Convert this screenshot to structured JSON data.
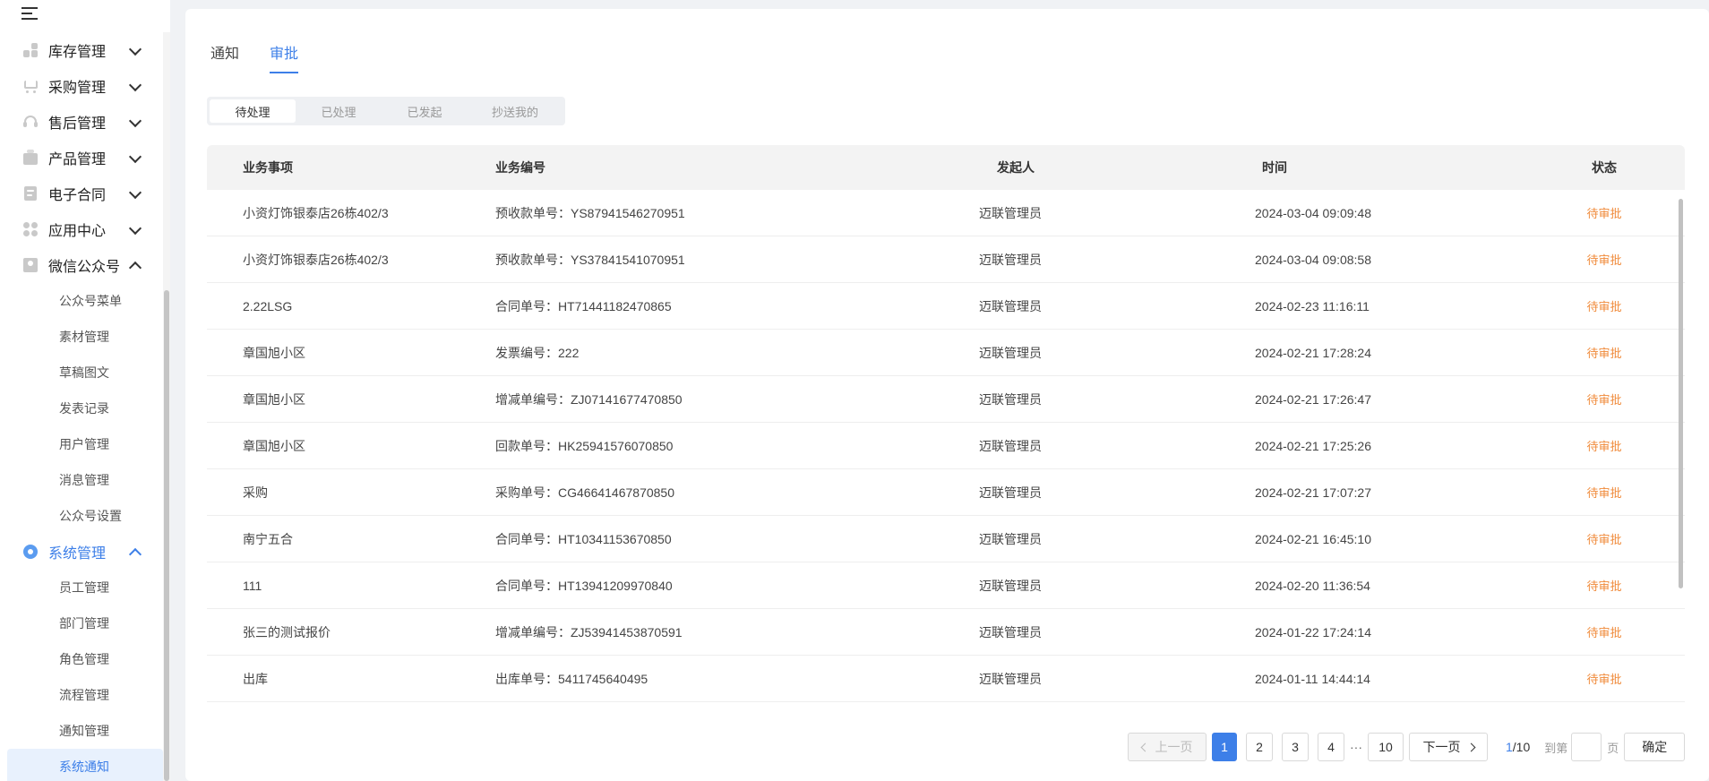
{
  "sidebar": {
    "groups": [
      {
        "label": "库存管理",
        "icon": "inventory-icon"
      },
      {
        "label": "采购管理",
        "icon": "cart-icon"
      },
      {
        "label": "售后管理",
        "icon": "headset-icon"
      },
      {
        "label": "产品管理",
        "icon": "product-icon"
      },
      {
        "label": "电子合同",
        "icon": "contract-icon"
      },
      {
        "label": "应用中心",
        "icon": "apps-icon"
      },
      {
        "label": "微信公众号",
        "icon": "wechat-official-icon"
      }
    ],
    "wechat_sub": [
      "公众号菜单",
      "素材管理",
      "草稿图文",
      "发表记录",
      "用户管理",
      "消息管理",
      "公众号设置"
    ],
    "system_group": {
      "label": "系统管理",
      "icon": "system-settings-icon"
    },
    "system_sub": [
      "员工管理",
      "部门管理",
      "角色管理",
      "流程管理",
      "通知管理",
      "系统通知"
    ],
    "accent_color": "#3d7fe8"
  },
  "main": {
    "tabs": [
      "通知",
      "审批"
    ],
    "active_tab": "审批",
    "segments": [
      "待处理",
      "已处理",
      "已发起",
      "抄送我的"
    ],
    "active_segment": "待处理",
    "table": {
      "headers": [
        "业务事项",
        "业务编号",
        "发起人",
        "时间",
        "状态"
      ],
      "rows": [
        [
          "小资灯饰银泰店26栋402/3",
          "预收款单号：YS87941546270951",
          "迈联管理员",
          "2024-03-04 09:09:48",
          "待审批"
        ],
        [
          "小资灯饰银泰店26栋402/3",
          "预收款单号：YS37841541070951",
          "迈联管理员",
          "2024-03-04 09:08:58",
          "待审批"
        ],
        [
          "2.22LSG",
          "合同单号：HT71441182470865",
          "迈联管理员",
          "2024-02-23 11:16:11",
          "待审批"
        ],
        [
          "章国旭小区",
          "发票编号：222",
          "迈联管理员",
          "2024-02-21 17:28:24",
          "待审批"
        ],
        [
          "章国旭小区",
          "增减单编号：ZJ07141677470850",
          "迈联管理员",
          "2024-02-21 17:26:47",
          "待审批"
        ],
        [
          "章国旭小区",
          "回款单号：HK25941576070850",
          "迈联管理员",
          "2024-02-21 17:25:26",
          "待审批"
        ],
        [
          "采购",
          "采购单号：CG46641467870850",
          "迈联管理员",
          "2024-02-21 17:07:27",
          "待审批"
        ],
        [
          "南宁五合",
          "合同单号：HT10341153670850",
          "迈联管理员",
          "2024-02-21 16:45:10",
          "待审批"
        ],
        [
          "111",
          "合同单号：HT13941209970840",
          "迈联管理员",
          "2024-02-20 11:36:54",
          "待审批"
        ],
        [
          "张三的测试报价",
          "增减单编号：ZJ53941453870591",
          "迈联管理员",
          "2024-01-22 17:24:14",
          "待审批"
        ],
        [
          "出库",
          "出库单号：5411745640495",
          "迈联管理员",
          "2024-01-11 14:44:14",
          "待审批"
        ]
      ],
      "status_color": "#f08a3a"
    },
    "pagination": {
      "prev": "上一页",
      "pages": [
        "1",
        "2",
        "3",
        "4"
      ],
      "ellipsis": "···",
      "last": "10",
      "next": "下一页",
      "current_page": "1",
      "total_pages": "/10",
      "goto_label": "到第",
      "page_unit": "页",
      "confirm": "确定"
    }
  }
}
